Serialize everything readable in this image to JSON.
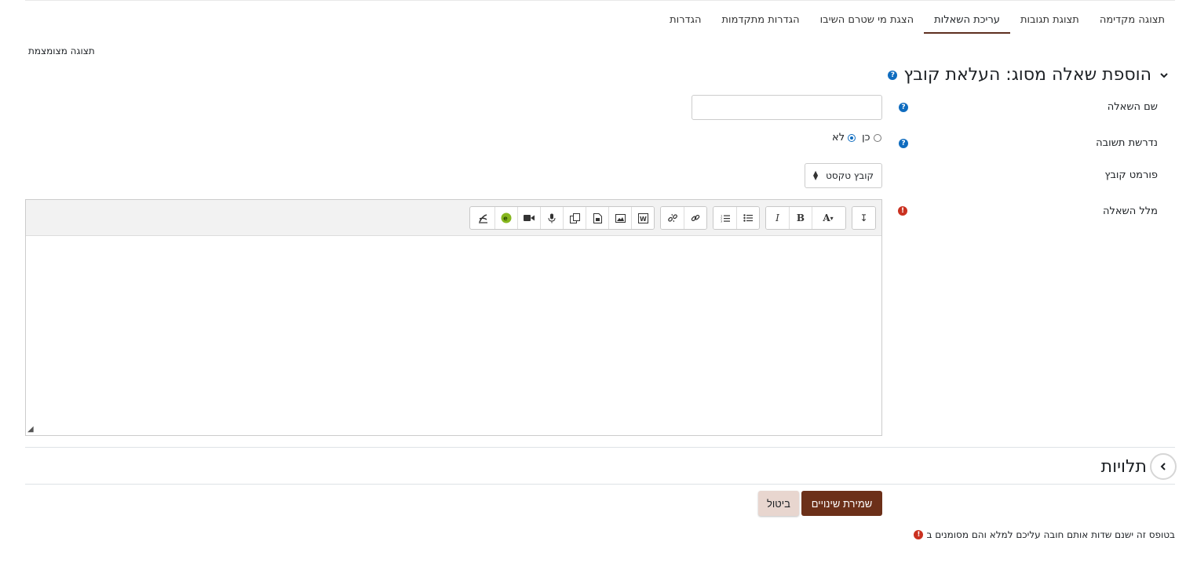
{
  "tabs": [
    {
      "label": "תצוגה מקדימה",
      "active": false
    },
    {
      "label": "תצוגת תגובות",
      "active": false
    },
    {
      "label": "עריכת השאלות",
      "active": true
    },
    {
      "label": "הצגת מי שטרם השיבו",
      "active": false
    },
    {
      "label": "הגדרות מתקדמות",
      "active": false
    },
    {
      "label": "הגדרות",
      "active": false
    }
  ],
  "compact_view": "תצוגה מצומצמת",
  "section": {
    "title": "הוספת שאלה מסוג: העלאת קובץ",
    "help_icon": "question-circle-icon",
    "toggle_icon": "chevron-down-icon"
  },
  "form": {
    "question_name_label": "שם השאלה",
    "question_name_value": "",
    "required_label": "נדרשת תשובה",
    "required_options": [
      {
        "label": "כן",
        "checked": false
      },
      {
        "label": "לא",
        "checked": true
      }
    ],
    "file_format_label": "פורמט קובץ",
    "file_format_value": "קובץ טקסט",
    "question_text_label": "מלל השאלה"
  },
  "editor": {
    "toolbar_icons": [
      "collapse-icon",
      "font-style-icon",
      "bold-icon",
      "italic-icon",
      "unordered-list-icon",
      "ordered-list-icon",
      "link-icon",
      "unlink-icon",
      "word-import-icon",
      "image-icon",
      "media-icon",
      "manage-files-icon",
      "record-audio-icon",
      "record-video-icon",
      "h5p-icon",
      "accessibility-checker-icon"
    ],
    "toolbar_text": {
      "bold": "B",
      "italic": "I",
      "font": "A"
    }
  },
  "dependencies": {
    "title": "תלויות",
    "toggle_icon": "chevron-left-icon"
  },
  "buttons": {
    "save": "שמירת שינויים",
    "cancel": "ביטול"
  },
  "required_note": "בטופס זה ישנם שדות אותם חובה עליכם למלא והם מסומנים ב",
  "colors": {
    "primary": "#6c3019",
    "help": "#0f6cbf",
    "required": "#ca3120",
    "cancel_bg": "#e8d6cf"
  }
}
